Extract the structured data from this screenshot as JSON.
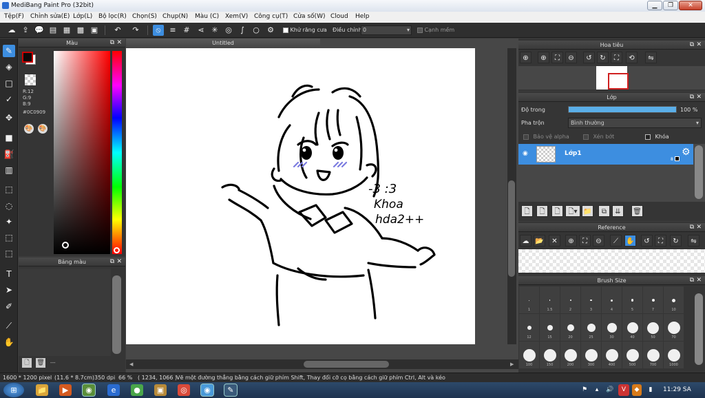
{
  "window": {
    "title": "MediBang Paint Pro (32bit)"
  },
  "menu": [
    "Tệp(F)",
    "Chỉnh sửa(E)",
    "Lớp(L)",
    "Bộ lọc(R)",
    "Chọn(S)",
    "Chụp(N)",
    "Màu (C)",
    "Xem(V)",
    "Công cụ(T)",
    "Cửa số(W)",
    "Cloud",
    "Help"
  ],
  "toolbar": {
    "antialias_label": "Khử răng cưa",
    "correction_label": "Điều chỉnh",
    "correction_value": "0",
    "soft_edge_label": "Cạnh mềm"
  },
  "color_panel": {
    "title": "Màu",
    "r": "R:12",
    "g": "G:9",
    "b": "B:9",
    "hex": "#0C0909",
    "fg_color": "#0c0909"
  },
  "palette_panel": {
    "title": "Bảng màu",
    "footer": "---"
  },
  "canvas": {
    "tab_title": "Untitled"
  },
  "navigator_panel": {
    "title": "Hoa tiêu"
  },
  "layer_panel": {
    "title": "Lớp",
    "opacity_label": "Độ trong",
    "opacity_value": "100 %",
    "opacity_fraction": 1.0,
    "blend_label": "Pha trộn",
    "blend_value": "Bình thường",
    "protect_alpha_label": "Bảo vệ alpha",
    "clip_label": "Xén bớt",
    "lock_label": "Khóa",
    "layers": [
      {
        "name": "Lớp1",
        "count": "8"
      }
    ]
  },
  "reference_panel": {
    "title": "Reference"
  },
  "brush_size_panel": {
    "title": "Brush Size",
    "sizes": [
      "1",
      "1.5",
      "2",
      "3",
      "4",
      "5",
      "7",
      "10",
      "12",
      "15",
      "20",
      "25",
      "30",
      "40",
      "50",
      "70",
      "100",
      "150",
      "200",
      "300",
      "400",
      "500",
      "700",
      "1000"
    ]
  },
  "status": {
    "dimensions": "1600 * 1200 pixel",
    "physical": "(11.6 * 8.7cm)",
    "dpi": "350 dpi",
    "zoom": "66 %",
    "coords": "( 1234, 1066 )",
    "hint": "Vẽ một đường thẳng bằng cách giữ phím Shift, Thay đổi cỡ cọ bằng cách giữ phím Ctrl, Alt và kéo"
  },
  "taskbar": {
    "time": "11:29 SA"
  },
  "drawing": {
    "handwriting_1": "-3 :3",
    "handwriting_2": "Khoa",
    "handwriting_3": "hda2++"
  }
}
